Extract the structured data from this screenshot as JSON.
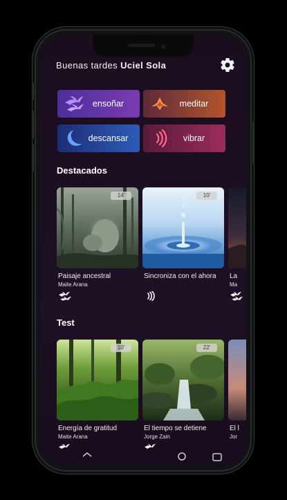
{
  "header": {
    "greeting_prefix": "Buenas tardes",
    "user_name": "Uciel Sola"
  },
  "categories": [
    {
      "label": "ensoñar",
      "icon": "birds-icon"
    },
    {
      "label": "meditar",
      "icon": "meditation-icon"
    },
    {
      "label": "descansar",
      "icon": "moon-icon"
    },
    {
      "label": "vibrar",
      "icon": "sound-wave-icon"
    }
  ],
  "sections": {
    "featured": {
      "title": "Destacados",
      "cards": [
        {
          "title": "Paisaje ancestral",
          "author": "Maite Arana",
          "duration": "14'",
          "icon": "birds-icon"
        },
        {
          "title": "Sincroniza con el ahora",
          "author": "",
          "duration": "10'",
          "icon": "sound-wave-icon"
        },
        {
          "title": "La",
          "author": "Ma",
          "icon": "birds-icon"
        }
      ]
    },
    "test": {
      "title": "Test",
      "cards": [
        {
          "title": "Energía de gratitud",
          "author": "Maite Arana",
          "duration": "10'",
          "icon": "birds-icon"
        },
        {
          "title": "El tiempo se detiene",
          "author": "Jorge Zain",
          "duration": "22'",
          "icon": "birds-icon"
        },
        {
          "title": "El l",
          "author": "Jor",
          "icon": "birds-icon"
        }
      ]
    }
  },
  "colors": {
    "ensonar": "#6a36aa",
    "meditar": "#b4542c",
    "descansar": "#2d5cb8",
    "vibrar": "#9b2c5c",
    "background": "#1d0f22"
  }
}
